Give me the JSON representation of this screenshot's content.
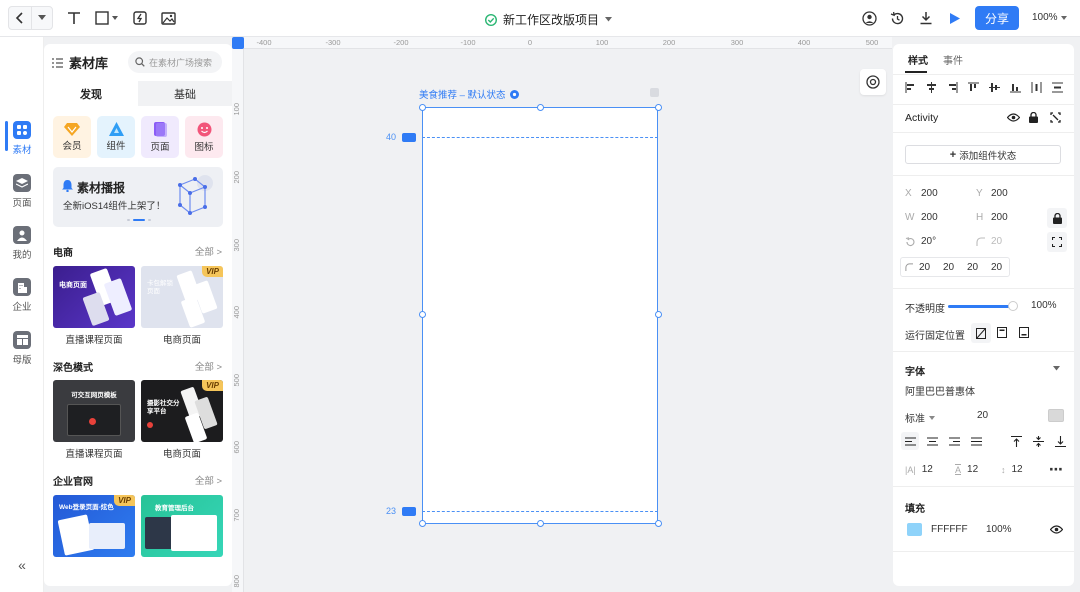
{
  "topbar": {
    "project_title": "新工作区改版项目",
    "share_label": "分享",
    "zoom_level": "100%"
  },
  "rail": {
    "items": [
      {
        "label": "素材"
      },
      {
        "label": "页面"
      },
      {
        "label": "我的"
      },
      {
        "label": "企业"
      },
      {
        "label": "母版"
      }
    ],
    "collapse_symbol": "«"
  },
  "library": {
    "title": "素材库",
    "search_placeholder": "在素材广场搜索",
    "tabs": [
      "发现",
      "基础"
    ],
    "tiles": [
      {
        "label": "会员",
        "color": "#f5a623",
        "bg": "#fff3e2"
      },
      {
        "label": "组件",
        "color": "#2f9ef5",
        "bg": "#e4f3fd"
      },
      {
        "label": "页面",
        "color": "#8b5cf6",
        "bg": "#f0eafd"
      },
      {
        "label": "图标",
        "color": "#f2557a",
        "bg": "#fde9ef"
      }
    ],
    "banner": {
      "title": "素材播报",
      "subtitle": "全新iOS14组件上架了！"
    },
    "sections": [
      {
        "title": "电商",
        "all": "全部 >",
        "items": [
          {
            "label": "直播课程页面",
            "thumb_title": "电商页面",
            "vip": false
          },
          {
            "label": "电商页面",
            "thumb_title": "卡包解锁页面",
            "vip": true
          }
        ]
      },
      {
        "title": "深色模式",
        "all": "全部 >",
        "items": [
          {
            "label": "直播课程页面",
            "thumb_title": "可交互网页模板",
            "vip": false
          },
          {
            "label": "电商页面",
            "thumb_title": "摄影社交分享平台",
            "vip": true
          }
        ]
      },
      {
        "title": "企业官网",
        "all": "全部 >",
        "items": [
          {
            "label": "",
            "thumb_title": "Web登录页面-炫色",
            "vip": true
          },
          {
            "label": "",
            "thumb_title": "教育管理后台",
            "vip": false
          }
        ]
      }
    ],
    "vip_label": "VIP"
  },
  "canvas": {
    "ruler_h": [
      "-400",
      "-300",
      "-200",
      "-100",
      "0",
      "100",
      "200",
      "300",
      "400",
      "500"
    ],
    "ruler_v": [
      "100",
      "200",
      "300",
      "400",
      "500",
      "600",
      "700",
      "800"
    ],
    "frame_label": "美食推荐 – 默认状态",
    "guide_top_value": "40",
    "guide_bottom_value": "23"
  },
  "props": {
    "tabs": [
      "样式",
      "事件"
    ],
    "component_name": "Activity",
    "add_state_label": "添加组件状态",
    "x_label": "X",
    "x": "200",
    "y_label": "Y",
    "y": "200",
    "w_label": "W",
    "w": "200",
    "h_label": "H",
    "h": "200",
    "rotation": "20°",
    "radius": "20",
    "corners": [
      "20",
      "20",
      "20",
      "20"
    ],
    "opacity_label": "不透明度",
    "opacity": "100%",
    "opacity_fraction": 1.0,
    "fixed_pos_label": "运行固定位置",
    "font_section": "字体",
    "font_family": "阿里巴巴普惠体",
    "font_weight": "标准",
    "font_size": "20",
    "letter_spacing": "12",
    "line_height": "12",
    "para_spacing": "12",
    "fill_section": "填充",
    "fill_hex": "FFFFFF",
    "fill_opacity": "100%"
  },
  "colors": {
    "accent": "#2f7bf5",
    "frame": "#4a90f5"
  }
}
